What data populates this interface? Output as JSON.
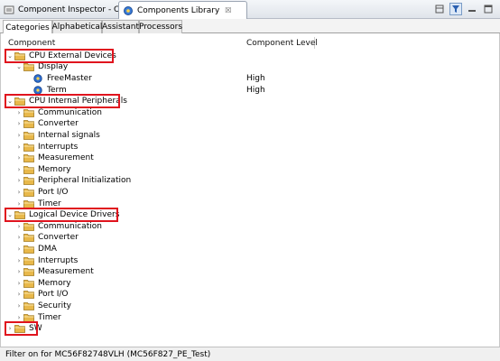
{
  "view_tabs": {
    "inspector": "Component Inspector - Cpu",
    "library": "Components Library",
    "close_glyph": "☒"
  },
  "sub_tabs": [
    "Categories",
    "Alphabetical",
    "Assistant",
    "Processors"
  ],
  "columns": {
    "component": "Component",
    "level": "Component Level"
  },
  "tree": [
    {
      "depth": 0,
      "expanded": true,
      "type": "folder",
      "label": "CPU External Devices",
      "level": ""
    },
    {
      "depth": 1,
      "expanded": true,
      "type": "folder",
      "label": "Display",
      "level": ""
    },
    {
      "depth": 2,
      "expanded": null,
      "type": "component",
      "label": "FreeMaster",
      "level": "High"
    },
    {
      "depth": 2,
      "expanded": null,
      "type": "component",
      "label": "Term",
      "level": "High"
    },
    {
      "depth": 0,
      "expanded": true,
      "type": "folder",
      "label": "CPU Internal Peripherals",
      "level": ""
    },
    {
      "depth": 1,
      "expanded": false,
      "type": "folder",
      "label": "Communication",
      "level": ""
    },
    {
      "depth": 1,
      "expanded": false,
      "type": "folder",
      "label": "Converter",
      "level": ""
    },
    {
      "depth": 1,
      "expanded": false,
      "type": "folder",
      "label": "Internal signals",
      "level": ""
    },
    {
      "depth": 1,
      "expanded": false,
      "type": "folder",
      "label": "Interrupts",
      "level": ""
    },
    {
      "depth": 1,
      "expanded": false,
      "type": "folder",
      "label": "Measurement",
      "level": ""
    },
    {
      "depth": 1,
      "expanded": false,
      "type": "folder",
      "label": "Memory",
      "level": ""
    },
    {
      "depth": 1,
      "expanded": false,
      "type": "folder",
      "label": "Peripheral Initialization",
      "level": ""
    },
    {
      "depth": 1,
      "expanded": false,
      "type": "folder",
      "label": "Port I/O",
      "level": ""
    },
    {
      "depth": 1,
      "expanded": false,
      "type": "folder",
      "label": "Timer",
      "level": ""
    },
    {
      "depth": 0,
      "expanded": true,
      "type": "folder",
      "label": "Logical Device Drivers",
      "level": ""
    },
    {
      "depth": 1,
      "expanded": false,
      "type": "folder",
      "label": "Communication",
      "level": ""
    },
    {
      "depth": 1,
      "expanded": false,
      "type": "folder",
      "label": "Converter",
      "level": ""
    },
    {
      "depth": 1,
      "expanded": false,
      "type": "folder",
      "label": "DMA",
      "level": ""
    },
    {
      "depth": 1,
      "expanded": false,
      "type": "folder",
      "label": "Interrupts",
      "level": ""
    },
    {
      "depth": 1,
      "expanded": false,
      "type": "folder",
      "label": "Measurement",
      "level": ""
    },
    {
      "depth": 1,
      "expanded": false,
      "type": "folder",
      "label": "Memory",
      "level": ""
    },
    {
      "depth": 1,
      "expanded": false,
      "type": "folder",
      "label": "Port I/O",
      "level": ""
    },
    {
      "depth": 1,
      "expanded": false,
      "type": "folder",
      "label": "Security",
      "level": ""
    },
    {
      "depth": 1,
      "expanded": false,
      "type": "folder",
      "label": "Timer",
      "level": ""
    },
    {
      "depth": 0,
      "expanded": false,
      "type": "folder",
      "label": "SW",
      "level": ""
    }
  ],
  "status": "Filter on for MC56F82748VLH (MC56F827_PE_Test)",
  "colors": {
    "highlight": "#e0141e",
    "folder": "#e8b84a"
  }
}
